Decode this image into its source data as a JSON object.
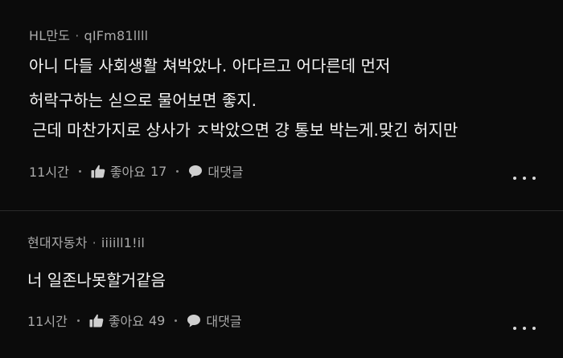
{
  "comments": [
    {
      "author": "HL만도",
      "separator": "·",
      "handle": "qIFm81llll",
      "lines": [
        "아니 다들 사회생활 쳐박았나. 아다르고 어다른데 먼저",
        "허락구하는 싣으로 물어보면 좋지.",
        "근데 마찬가지로 상사가 ㅈ박았으면 걍 통보 박는게.맞긴 허지만"
      ],
      "time": "11시간",
      "like_label": "좋아요",
      "like_count": "17",
      "reply_label": "대댓글"
    },
    {
      "author": "현대자동차",
      "separator": "·",
      "handle": "iiiill1!il",
      "lines": [
        "너 일존나못할거같음"
      ],
      "time": "11시간",
      "like_label": "좋아요",
      "like_count": "49",
      "reply_label": "대댓글"
    }
  ],
  "icons": {
    "like": "thumbs-up-icon",
    "reply": "speech-bubble-icon",
    "more": "more-dots-icon"
  },
  "colors": {
    "background": "#0b0b0b",
    "text": "#f4f4f4",
    "muted": "#a9a9a9"
  }
}
